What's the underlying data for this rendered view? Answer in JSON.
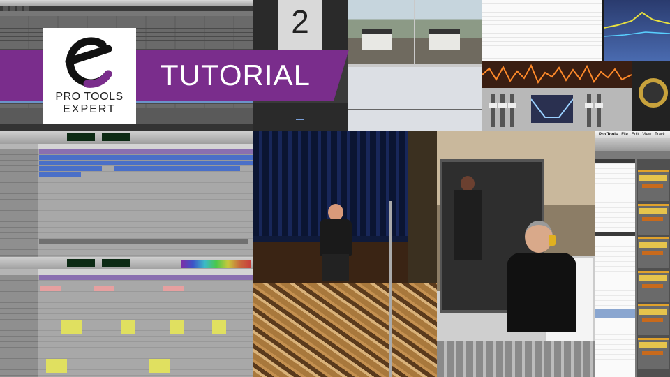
{
  "banner": {
    "title": "TUTORIAL",
    "color": "#7a2d8c"
  },
  "logo": {
    "line1": "PRO TOOLS",
    "line2": "EXPERT",
    "icon": "e-logo-icon"
  },
  "clapper": {
    "number": "2"
  },
  "mix_window": {
    "menu": [
      "Pro Tools",
      "File",
      "Edit",
      "View",
      "Track"
    ]
  },
  "colors": {
    "accent_purple": "#7a2d8c",
    "selection_blue": "#6b93c9",
    "counter_green": "#6dff7e",
    "strip_orange": "#e0a22c"
  }
}
